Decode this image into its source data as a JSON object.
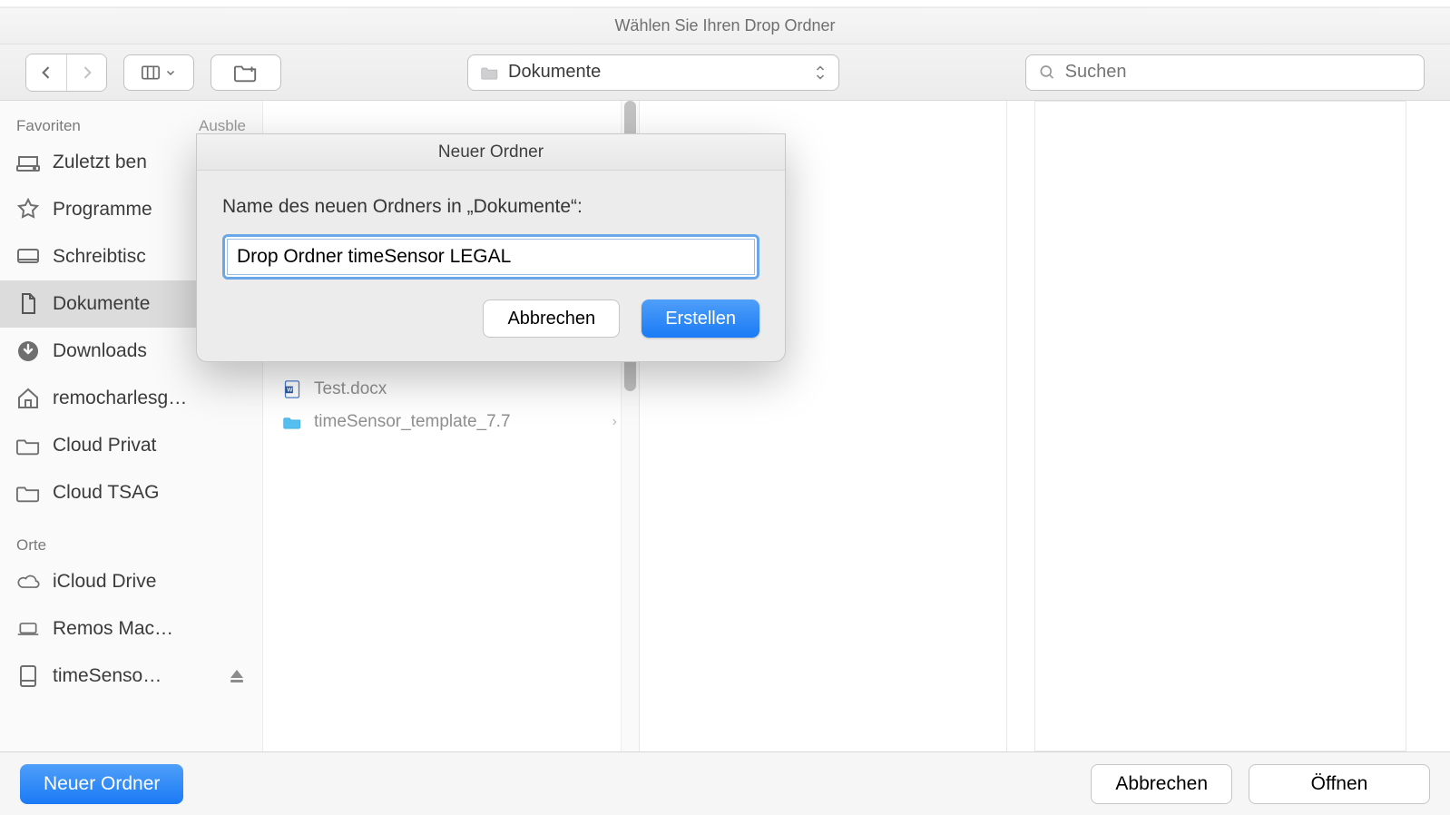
{
  "window_title": "Wählen Sie Ihren Drop Ordner",
  "toolbar": {
    "location_label": "Dokumente",
    "search_placeholder": "Suchen"
  },
  "sidebar": {
    "group_favorites": "Favoriten",
    "hide_label": "Ausble",
    "items": [
      {
        "label": "Zuletzt ben",
        "icon": "recents-icon"
      },
      {
        "label": "Programme",
        "icon": "applications-icon"
      },
      {
        "label": "Schreibtisc",
        "icon": "desktop-icon"
      },
      {
        "label": "Dokumente",
        "icon": "documents-icon",
        "selected": true
      },
      {
        "label": "Downloads",
        "icon": "downloads-icon"
      },
      {
        "label": "remocharlesg…",
        "icon": "home-icon"
      },
      {
        "label": "Cloud Privat",
        "icon": "folder-icon"
      },
      {
        "label": "Cloud TSAG",
        "icon": "folder-icon"
      }
    ],
    "group_locations": "Orte",
    "locations": [
      {
        "label": "iCloud Drive",
        "icon": "cloud-icon"
      },
      {
        "label": "Remos Mac…",
        "icon": "laptop-icon"
      },
      {
        "label": "timeSenso…",
        "icon": "disk-icon",
        "ejectable": true
      }
    ]
  },
  "column1": {
    "visible_rows": [
      {
        "label": "Test.docx",
        "icon": "word-doc-icon"
      },
      {
        "label": "timeSensor_template_7.7",
        "icon": "folder-blue-icon",
        "is_folder": true
      }
    ]
  },
  "bottom": {
    "new_folder": "Neuer Ordner",
    "cancel": "Abbrechen",
    "open": "Öffnen"
  },
  "sheet": {
    "title": "Neuer Ordner",
    "prompt": "Name des neuen Ordners in „Dokumente“:",
    "input_value": "Drop Ordner timeSensor LEGAL",
    "cancel": "Abbrechen",
    "create": "Erstellen"
  }
}
